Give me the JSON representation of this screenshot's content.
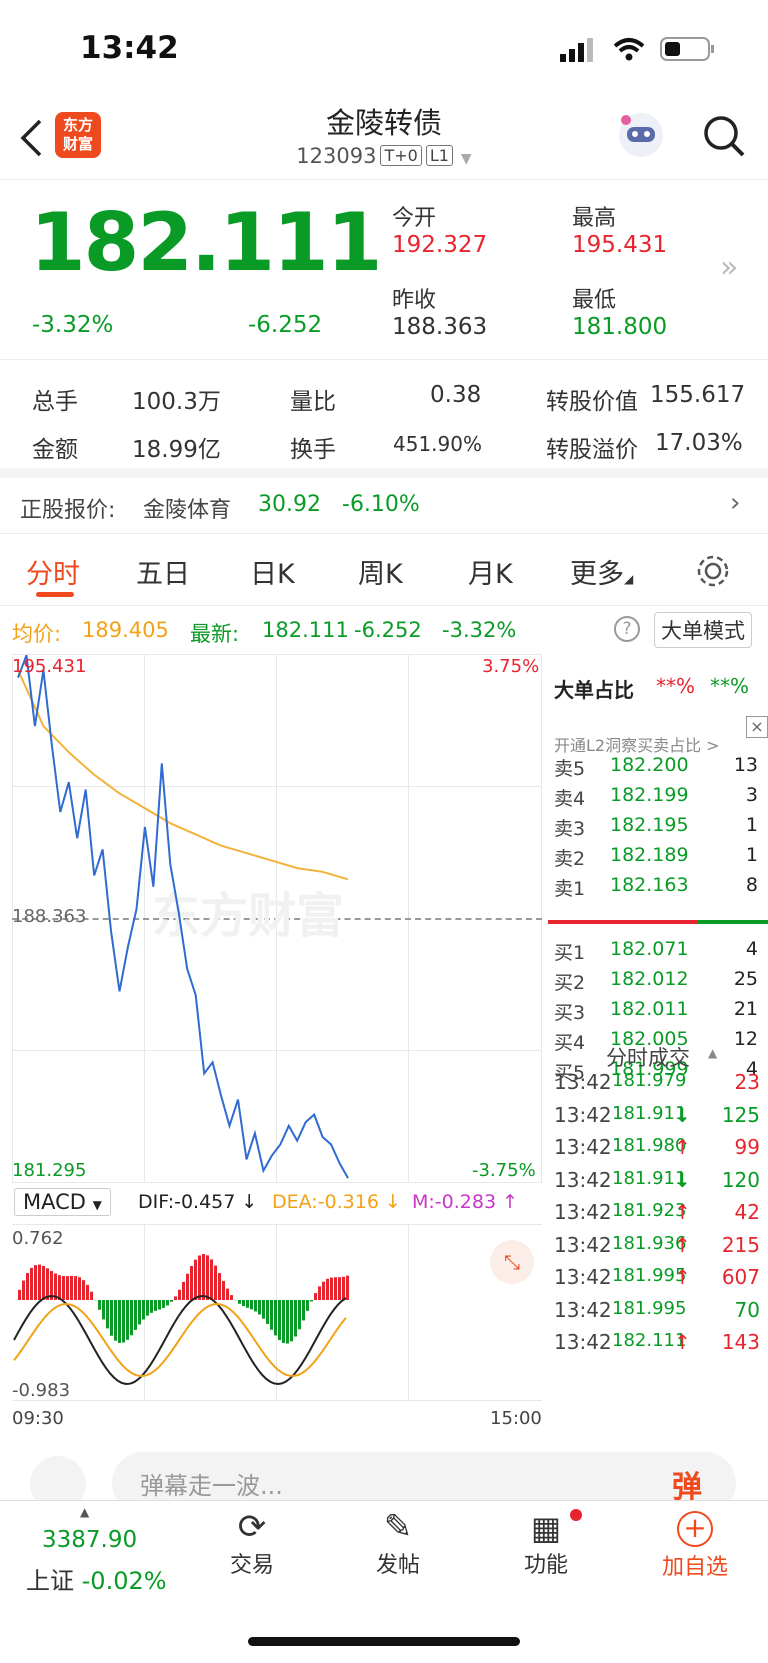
{
  "status": {
    "time": "13:42"
  },
  "header": {
    "title": "金陵转债",
    "code": "123093",
    "tag1": "T+0",
    "tag2": "L1",
    "logo": "东方\n财富"
  },
  "quote": {
    "price": "182.111",
    "pct": "-3.32%",
    "chg": "-6.252",
    "open_label": "今开",
    "open": "192.327",
    "high_label": "最高",
    "high": "195.431",
    "prev_label": "昨收",
    "prev": "188.363",
    "low_label": "最低",
    "low": "181.800"
  },
  "stats": [
    {
      "label": "总手",
      "value": "100.3万"
    },
    {
      "label": "量比",
      "value": "0.38"
    },
    {
      "label": "转股价值",
      "value": "155.617"
    },
    {
      "label": "金额",
      "value": "18.99亿"
    },
    {
      "label": "换手",
      "value": "451.90%"
    },
    {
      "label": "转股溢价",
      "value": "17.03%"
    }
  ],
  "stock": {
    "label": "正股报价:",
    "name": "金陵体育",
    "price": "30.92",
    "pct": "-6.10%"
  },
  "tabs": [
    "分时",
    "五日",
    "日K",
    "周K",
    "月K",
    "更多"
  ],
  "info": {
    "avg_label": "均价:",
    "avg": "189.405",
    "last_label": "最新:",
    "last": "182.111",
    "chg": "-6.252",
    "pct": "-3.32%",
    "mode": "大单模式"
  },
  "chart": {
    "max": "195.431",
    "max_pct": "3.75%",
    "min": "181.295",
    "min_pct": "-3.75%",
    "ref": "188.363",
    "watermark": "东方财富",
    "open_time": "09:30",
    "close_time": "15:00"
  },
  "macd": {
    "name": "MACD",
    "dif": "DIF:-0.457 ↓",
    "dea": "DEA:-0.316 ↓",
    "m": "M:-0.283 ↑",
    "max": "0.762",
    "min": "-0.983"
  },
  "chart_data": {
    "type": "line",
    "series": [
      {
        "values": [
          194.8,
          195.4,
          193.5,
          195,
          193,
          191.2,
          192,
          190.5,
          191.8,
          189.5,
          190.2,
          188,
          186.4,
          187.6,
          188.6,
          190.8,
          189.2,
          192.5,
          189.8,
          188.5,
          187,
          186.3,
          184.2,
          184.5,
          183.6,
          182.8,
          183.5,
          181.9,
          182.6,
          181.6,
          182,
          182.3,
          182.8,
          182.4,
          182.9,
          183.1,
          182.5,
          182.3,
          181.8,
          181.4
        ]
      },
      {
        "values": [
          195,
          193.5,
          192.8,
          192.2,
          191.7,
          191.3,
          190.9,
          190.6,
          190.3,
          190.1,
          189.9,
          189.7,
          189.6,
          189.4
        ]
      }
    ],
    "ylim": [
      181.295,
      195.431
    ]
  },
  "orderbook": {
    "header1": "大单占比",
    "h1v1": "**%",
    "h1v2": "**%",
    "banner": "开通L2洞察买卖占比 >",
    "asks": [
      {
        "l": "卖5",
        "p": "182.200",
        "v": "13"
      },
      {
        "l": "卖4",
        "p": "182.199",
        "v": "3"
      },
      {
        "l": "卖3",
        "p": "182.195",
        "v": "1"
      },
      {
        "l": "卖2",
        "p": "182.189",
        "v": "1"
      },
      {
        "l": "卖1",
        "p": "182.163",
        "v": "8"
      }
    ],
    "bids": [
      {
        "l": "买1",
        "p": "182.071",
        "v": "4"
      },
      {
        "l": "买2",
        "p": "182.012",
        "v": "25"
      },
      {
        "l": "买3",
        "p": "182.011",
        "v": "21"
      },
      {
        "l": "买4",
        "p": "182.005",
        "v": "12"
      },
      {
        "l": "买5",
        "p": "181.999",
        "v": "4"
      }
    ]
  },
  "trades": {
    "title": "分时成交",
    "rows": [
      {
        "t": "13:42",
        "p": "181.979",
        "a": "",
        "v": "23",
        "c": "red"
      },
      {
        "t": "13:42",
        "p": "181.911",
        "a": "↓",
        "v": "125",
        "c": "green"
      },
      {
        "t": "13:42",
        "p": "181.980",
        "a": "↑",
        "v": "99",
        "c": "red"
      },
      {
        "t": "13:42",
        "p": "181.911",
        "a": "↓",
        "v": "120",
        "c": "green"
      },
      {
        "t": "13:42",
        "p": "181.923",
        "a": "↑",
        "v": "42",
        "c": "red"
      },
      {
        "t": "13:42",
        "p": "181.936",
        "a": "↑",
        "v": "215",
        "c": "red"
      },
      {
        "t": "13:42",
        "p": "181.995",
        "a": "↑",
        "v": "607",
        "c": "red"
      },
      {
        "t": "13:42",
        "p": "181.995",
        "a": "",
        "v": "70",
        "c": "green"
      },
      {
        "t": "13:42",
        "p": "182.111",
        "a": "↑",
        "v": "143",
        "c": "red"
      }
    ]
  },
  "comment": {
    "placeholder": "弹幕走一波...",
    "btn": "弹"
  },
  "bottom": {
    "index_val": "3387.90",
    "index_name": "上证",
    "index_pct": "-0.02%",
    "trade": "交易",
    "post": "发帖",
    "func": "功能",
    "add": "加自选"
  }
}
